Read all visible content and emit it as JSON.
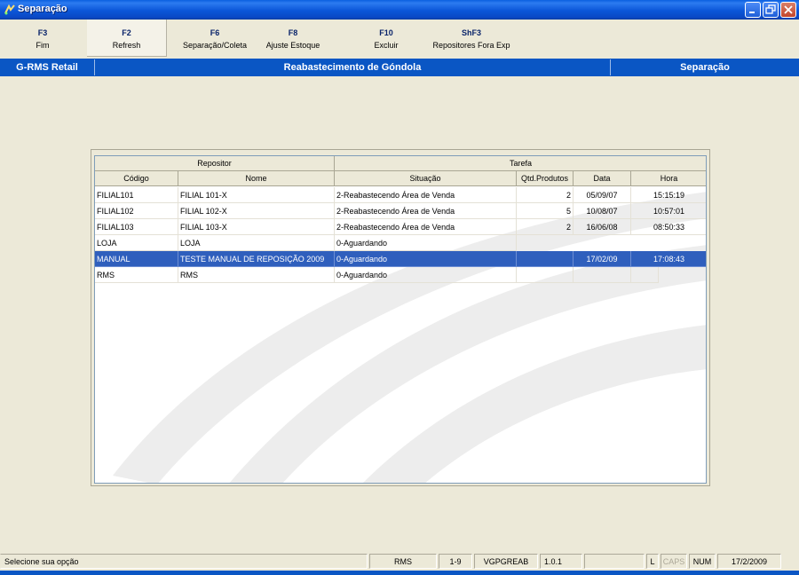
{
  "window": {
    "title": "Separação",
    "colors": {
      "titlebar": "#0A56C4",
      "header": "#0A56C4",
      "selection": "#2F5FBD"
    }
  },
  "toolbar": [
    {
      "key": "F3",
      "label": "Fim"
    },
    {
      "key": "F2",
      "label": "Refresh"
    },
    {
      "key": "F6",
      "label": "Separação/Coleta"
    },
    {
      "key": "F8",
      "label": "Ajuste Estoque"
    },
    {
      "key": "F10",
      "label": "Excluir"
    },
    {
      "key": "ShF3",
      "label": "Repositores Fora Exp"
    }
  ],
  "header": {
    "left": "G-RMS Retail",
    "center": "Reabastecimento de Góndola",
    "right": "Separação"
  },
  "table": {
    "group_headers": [
      "Repositor",
      "Tarefa"
    ],
    "columns": [
      "Código",
      "Nome",
      "Situação",
      "Qtd.Produtos",
      "Data",
      "Hora"
    ],
    "rows": [
      [
        "FILIAL101",
        "FILIAL 101-X",
        "2-Reabastecendo Área de Venda",
        "2",
        "05/09/07",
        "15:15:19"
      ],
      [
        "FILIAL102",
        "FILIAL 102-X",
        "2-Reabastecendo Área de Venda",
        "5",
        "10/08/07",
        "10:57:01"
      ],
      [
        "FILIAL103",
        "FILIAL 103-X",
        "2-Reabastecendo Área de Venda",
        "2",
        "16/06/08",
        "08:50:33"
      ],
      [
        "LOJA",
        "LOJA",
        "0-Aguardando",
        "",
        "",
        ""
      ],
      [
        "MANUAL",
        "TESTE MANUAL DE REPOSIÇÃO 2009",
        "0-Aguardando",
        "",
        "17/02/09",
        "17:08:43"
      ],
      [
        "RMS",
        "RMS",
        "0-Aguardando",
        "",
        "",
        ""
      ]
    ],
    "selected_row": 4
  },
  "status": {
    "message": "Selecione sua opção",
    "user": "RMS",
    "range": "1-9",
    "program": "VGPGREAB",
    "version": "1.0.1",
    "blank": "",
    "l": "L",
    "caps": "CAPS",
    "num": "NUM",
    "date": "17/2/2009"
  }
}
